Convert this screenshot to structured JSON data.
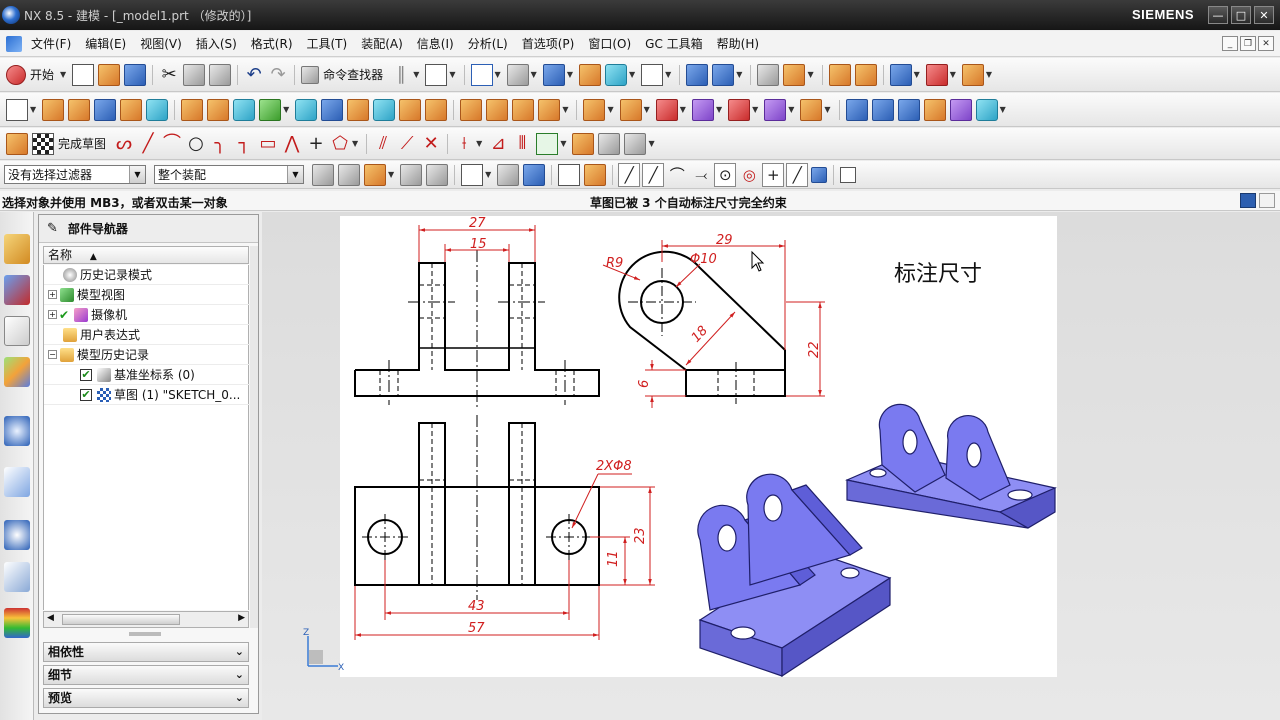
{
  "window": {
    "title": "NX 8.5 - 建模 - [_model1.prt （修改的）]",
    "brand": "SIEMENS",
    "minimize": "—",
    "maximize": "□",
    "close": "✕"
  },
  "menu": {
    "items": [
      "文件(F)",
      "编辑(E)",
      "视图(V)",
      "插入(S)",
      "格式(R)",
      "工具(T)",
      "装配(A)",
      "信息(I)",
      "分析(L)",
      "首选项(P)",
      "窗口(O)",
      "GC 工具箱",
      "帮助(H)"
    ]
  },
  "toolbar1": {
    "start_label": "开始",
    "command_finder_label": "命令查找器"
  },
  "toolbar3": {
    "finish_sketch_label": "完成草图"
  },
  "filter": {
    "selection_filter": "没有选择过滤器",
    "scope": "整个装配"
  },
  "cue": {
    "prompt": "选择对象并使用 MB3，或者双击某一对象",
    "status": "草图已被 3 个自动标注尺寸完全约束"
  },
  "navigator": {
    "title": "部件导航器",
    "column_name": "名称",
    "rows": [
      {
        "label": "历史记录模式"
      },
      {
        "label": "模型视图"
      },
      {
        "label": "摄像机"
      },
      {
        "label": "用户表达式"
      },
      {
        "label": "模型历史记录"
      },
      {
        "label": "基准坐标系 (0)"
      },
      {
        "label": "草图 (1) \"SKETCH_0..."
      }
    ],
    "panels": [
      "相依性",
      "细节",
      "预览"
    ]
  },
  "graphics": {
    "annotation_title": "标注尺寸",
    "dimensions": {
      "front_top_overall": "27",
      "front_top_inner": "15",
      "radius": "R9",
      "hole_dia": "Φ10",
      "side_width": "29",
      "side_slant": "18",
      "side_height": "22",
      "side_base": "6",
      "holes": "2XΦ8",
      "plan_height": "23",
      "plan_hole_height": "11",
      "plan_hole_spacing": "43",
      "plan_width": "57"
    },
    "triad_z": "Z",
    "triad_x": "X"
  },
  "colors": {
    "drawing_red": "#d01f1f",
    "model_blue": "#7b7bf0",
    "title_bar": "#1e1e1e"
  }
}
